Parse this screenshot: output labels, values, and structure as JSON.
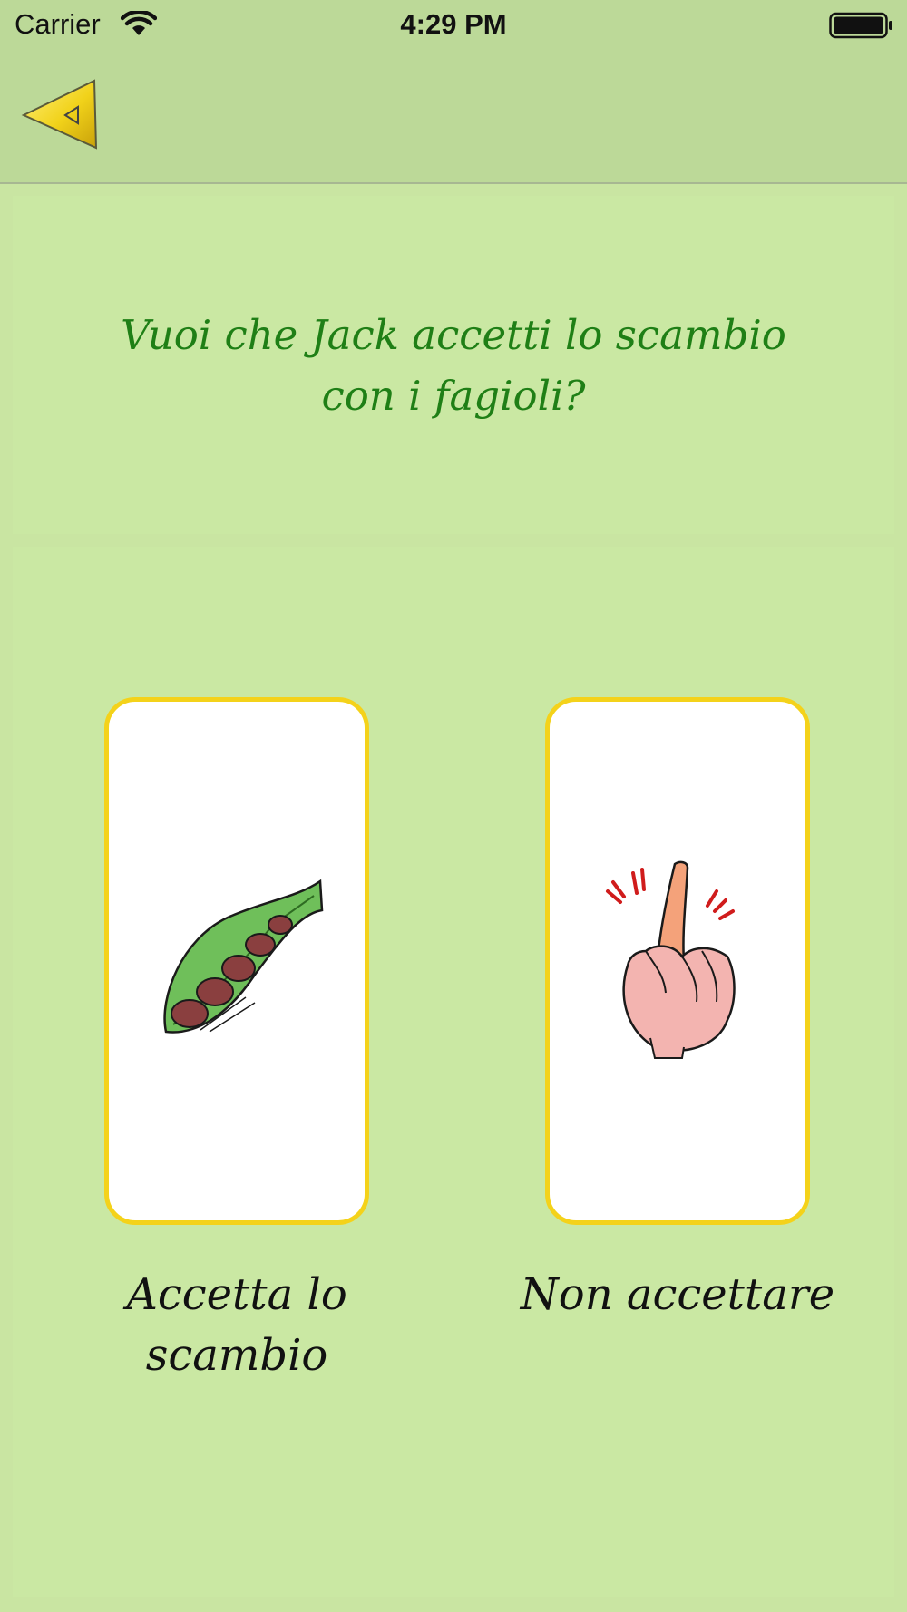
{
  "status_bar": {
    "carrier": "Carrier",
    "time": "4:29 PM",
    "wifi_icon": "wifi-icon",
    "battery_icon": "battery-icon"
  },
  "navbar": {
    "back_icon": "back-arrow-icon"
  },
  "question": {
    "text": "Vuoi che Jack accetti lo scambio con i fagioli?"
  },
  "choices": [
    {
      "label": "Accetta lo scambio",
      "icon": "bean-pod-icon"
    },
    {
      "label": "Non accettare",
      "icon": "finger-wag-icon"
    }
  ],
  "colors": {
    "background": "#c9e5a2",
    "bar": "#bcd998",
    "question_text": "#1f7f16",
    "card_border": "#f4d21a"
  }
}
